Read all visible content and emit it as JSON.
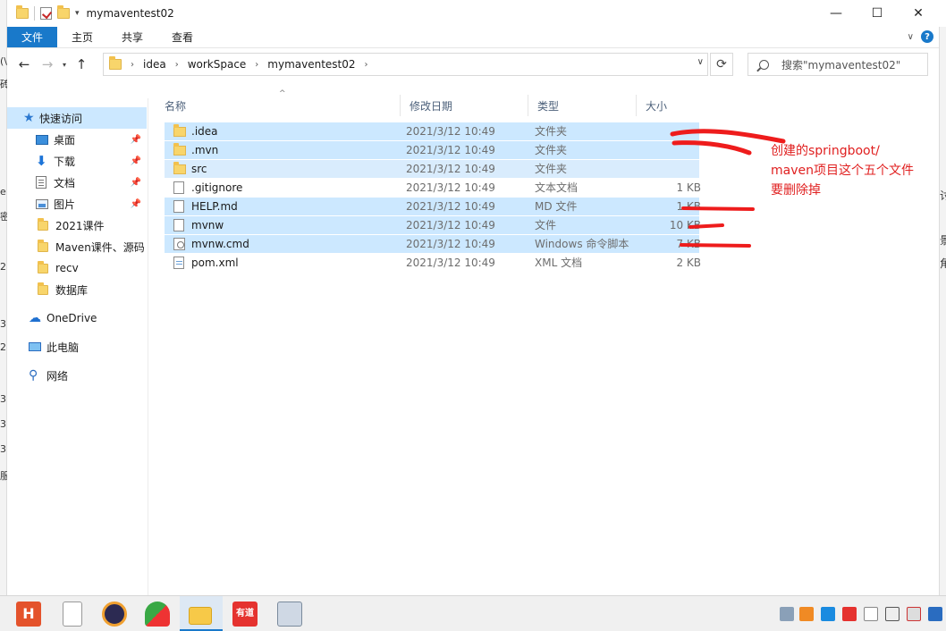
{
  "window": {
    "title": "mymaventest02",
    "controls": {
      "minimize": "—",
      "maximize": "☐",
      "close": "✕"
    }
  },
  "ribbon": {
    "tabs": [
      {
        "label": "文件",
        "active": true
      },
      {
        "label": "主页",
        "active": false
      },
      {
        "label": "共享",
        "active": false
      },
      {
        "label": "查看",
        "active": false
      }
    ],
    "help": "?"
  },
  "address": {
    "breadcrumbs": [
      "idea",
      "workSpace",
      "mymaventest02"
    ],
    "search_placeholder": "搜索\"mymaventest02\""
  },
  "sidebar": {
    "items": [
      {
        "label": "快速访问",
        "icon": "star-icon",
        "selected": true,
        "pinned": false
      },
      {
        "label": "桌面",
        "icon": "desktop-icon",
        "pinned": true
      },
      {
        "label": "下载",
        "icon": "download-icon",
        "pinned": true
      },
      {
        "label": "文档",
        "icon": "document-icon",
        "pinned": true
      },
      {
        "label": "图片",
        "icon": "picture-icon",
        "pinned": true
      },
      {
        "label": "2021课件",
        "icon": "folder-icon"
      },
      {
        "label": "Maven课件、源码",
        "icon": "folder-icon"
      },
      {
        "label": "recv",
        "icon": "folder-icon"
      },
      {
        "label": "数据库",
        "icon": "folder-icon"
      },
      {
        "label": "OneDrive",
        "icon": "onedrive-icon"
      },
      {
        "label": "此电脑",
        "icon": "this-pc-icon"
      },
      {
        "label": "网络",
        "icon": "network-icon"
      }
    ]
  },
  "columns": {
    "name": "名称",
    "date": "修改日期",
    "type": "类型",
    "size": "大小"
  },
  "files": [
    {
      "name": ".idea",
      "date": "2021/3/12 10:49",
      "type": "文件夹",
      "size": "",
      "icon": "folder",
      "selected": true
    },
    {
      "name": ".mvn",
      "date": "2021/3/12 10:49",
      "type": "文件夹",
      "size": "",
      "icon": "folder",
      "selected": true
    },
    {
      "name": "src",
      "date": "2021/3/12 10:49",
      "type": "文件夹",
      "size": "",
      "icon": "folder",
      "selected": "light"
    },
    {
      "name": ".gitignore",
      "date": "2021/3/12 10:49",
      "type": "文本文档",
      "size": "1 KB",
      "icon": "file",
      "selected": false
    },
    {
      "name": "HELP.md",
      "date": "2021/3/12 10:49",
      "type": "MD 文件",
      "size": "1 KB",
      "icon": "file",
      "selected": true
    },
    {
      "name": "mvnw",
      "date": "2021/3/12 10:49",
      "type": "文件",
      "size": "10 KB",
      "icon": "file",
      "selected": true
    },
    {
      "name": "mvnw.cmd",
      "date": "2021/3/12 10:49",
      "type": "Windows 命令脚本",
      "size": "7 KB",
      "icon": "cmd",
      "selected": true
    },
    {
      "name": "pom.xml",
      "date": "2021/3/12 10:49",
      "type": "XML 文档",
      "size": "2 KB",
      "icon": "xml",
      "selected": false
    }
  ],
  "annotation": {
    "lines": [
      "创建的springboot/",
      "maven项目这个五个文件",
      "要删除掉"
    ],
    "color": "#e02020"
  },
  "taskbar": {
    "apps": [
      "hbuilder-icon",
      "notepad-icon",
      "eclipse-icon",
      "app-icon",
      "file-explorer-icon",
      "youdao-icon",
      "monitor-icon"
    ],
    "tray": [
      "tray-icon-1",
      "tray-icon-2",
      "tray-icon-3",
      "tray-icon-4",
      "network-tray-icon",
      "security-tray-icon",
      "shield-tray-icon"
    ]
  }
}
